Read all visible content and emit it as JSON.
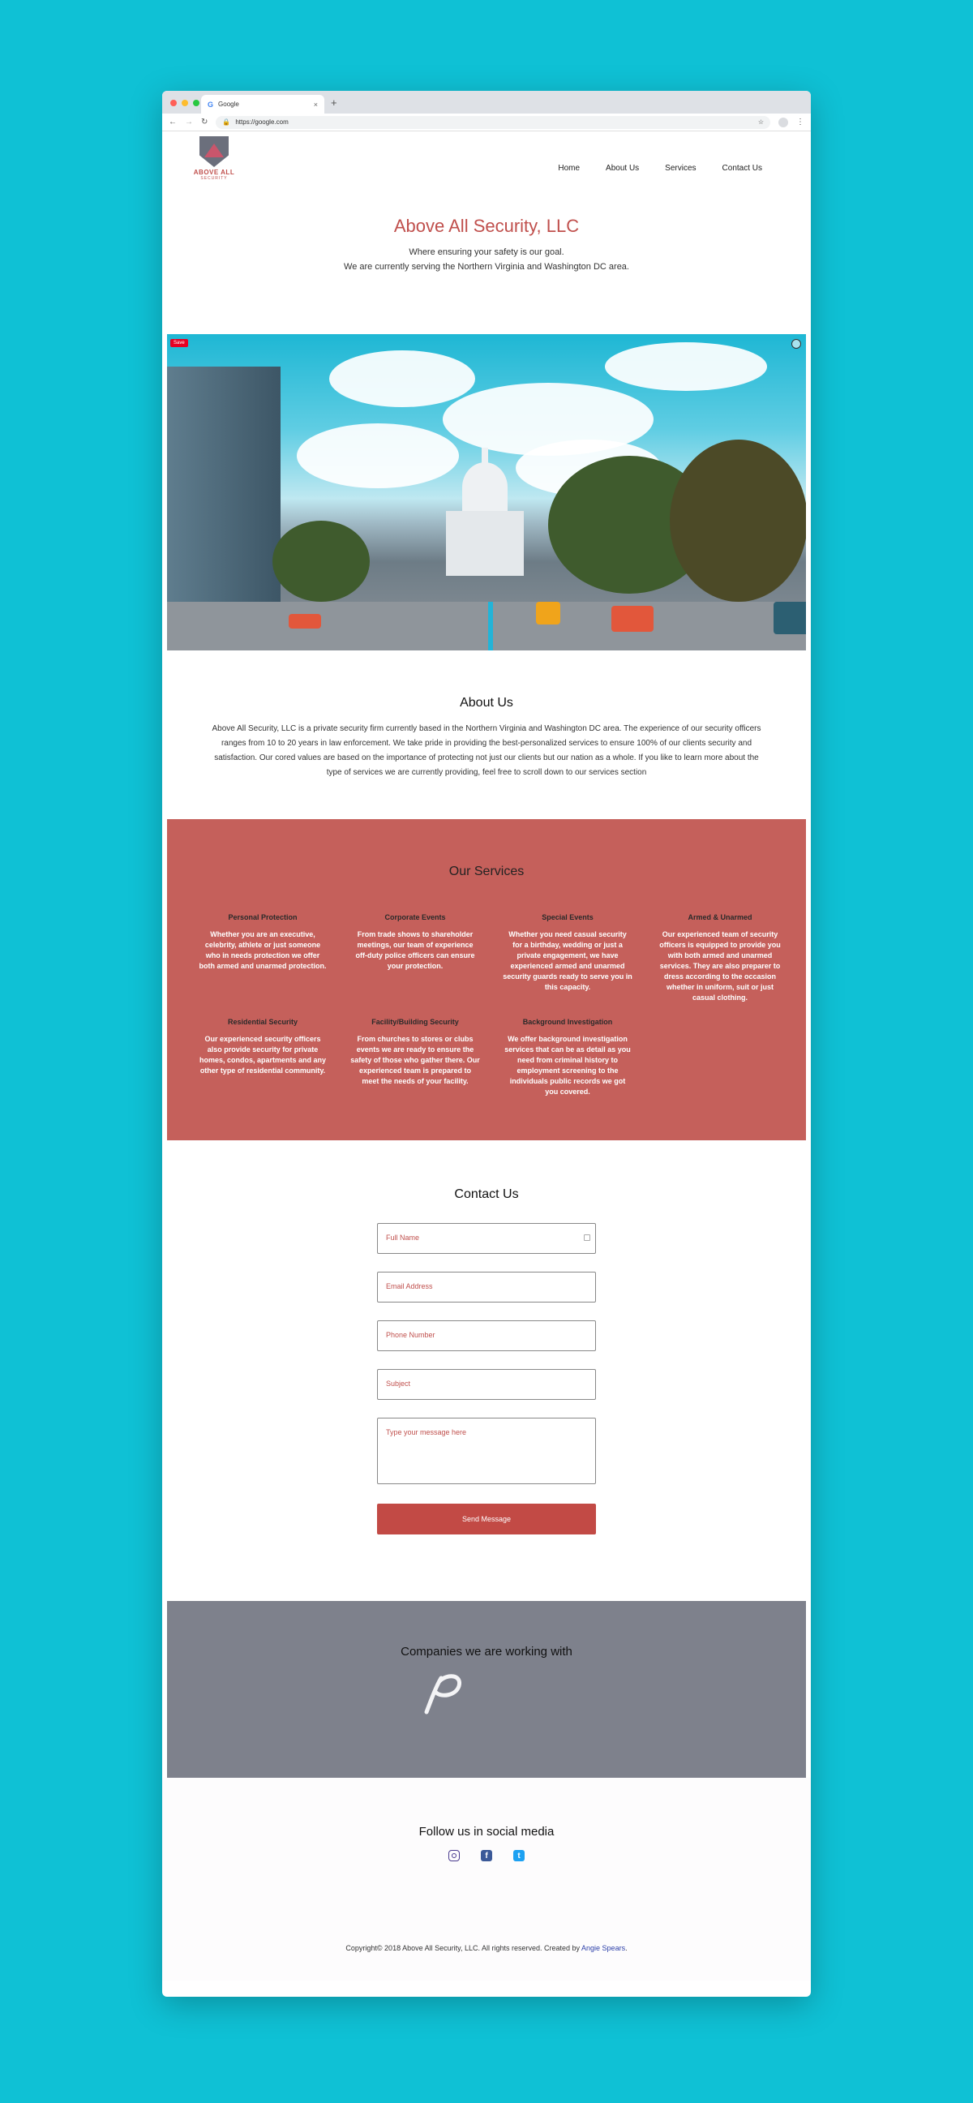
{
  "browser": {
    "tab_title": "Google",
    "tab_close": "×",
    "new_tab": "+",
    "url": "https://google.com",
    "nav_icons": [
      "arrow-left-icon",
      "arrow-right-icon",
      "reload-icon"
    ],
    "dot_colors": [
      "#ff5f57",
      "#febc2e",
      "#28c840"
    ]
  },
  "site": {
    "logo": {
      "line1": "ABOVE ALL",
      "line2": "SECURITY"
    },
    "nav": [
      "Home",
      "About Us",
      "Services",
      "Contact Us"
    ],
    "hero": {
      "title": "Above All Security, LLC",
      "tagline": "Where ensuring your safety is our goal.",
      "area": "We are currently serving the Northern Virginia and Washington DC area."
    },
    "photo": {
      "save_badge": "Save"
    },
    "about": {
      "title": "About Us",
      "text": "Above All Security, LLC is a private security firm currently based in the Northern Virginia and Washington DC area. The experience of our security officers ranges from 10 to 20 years in law enforcement. We take pride in providing the best-personalized services to ensure 100% of our clients security and satisfaction. Our cored values are based on the importance of protecting not just our clients but our nation as a whole. If you like to learn more about the type of services we are currently providing, feel free to scroll down to our services section"
    },
    "services": {
      "title": "Our Services",
      "items": [
        {
          "title": "Personal Protection",
          "text": "Whether you are an executive, celebrity, athlete or just someone who in needs protection we offer both armed and unarmed protection."
        },
        {
          "title": "Corporate Events",
          "text": "From trade shows to shareholder meetings, our team of experience off-duty police officers can ensure your protection."
        },
        {
          "title": "Special Events",
          "text": "Whether you need casual security for a birthday, wedding or just a private engagement, we have experienced armed and unarmed security guards ready to serve you in this capacity."
        },
        {
          "title": "Armed & Unarmed",
          "text": "Our experienced team of security officers is equipped to provide you with both armed and unarmed services. They are also preparer to dress according to the occasion whether in uniform, suit or just casual clothing."
        },
        {
          "title": "Residential Security",
          "text": "Our experienced security officers also provide security for private homes, condos, apartments and any other type of residential community."
        },
        {
          "title": "Facility/Building Security",
          "text": "From churches to stores or clubs events we are ready to ensure the safety of those who gather there. Our experienced team is prepared to meet the needs of your facility."
        },
        {
          "title": "Background Investigation",
          "text": "We offer background investigation services that can be as detail as you need from criminal history to employment screening to the individuals public records we got you covered."
        }
      ]
    },
    "contact": {
      "title": "Contact Us",
      "full_name": "Full Name",
      "email": "Email Address",
      "phone": "Phone Number",
      "subject": "Subject",
      "message": "Type your message here",
      "send": "Send Message"
    },
    "partners": {
      "title": "Companies we are working with"
    },
    "social": {
      "title": "Follow us in social media",
      "icons": [
        "instagram-icon",
        "facebook-icon",
        "twitter-icon"
      ],
      "colors": {
        "instagram": "#4a3b8f",
        "facebook": "#3b5998",
        "twitter": "#1da1f2"
      }
    },
    "footer": {
      "text": "Copyright© 2018 Above All Security, LLC. All rights reserved. Created by ",
      "author": "Angie Spears",
      "end": "."
    },
    "colors": {
      "accent": "#c0504d",
      "services_bg": "#c5605b",
      "partners_bg": "#7e818c",
      "page_bg": "#0fc1d5"
    }
  }
}
